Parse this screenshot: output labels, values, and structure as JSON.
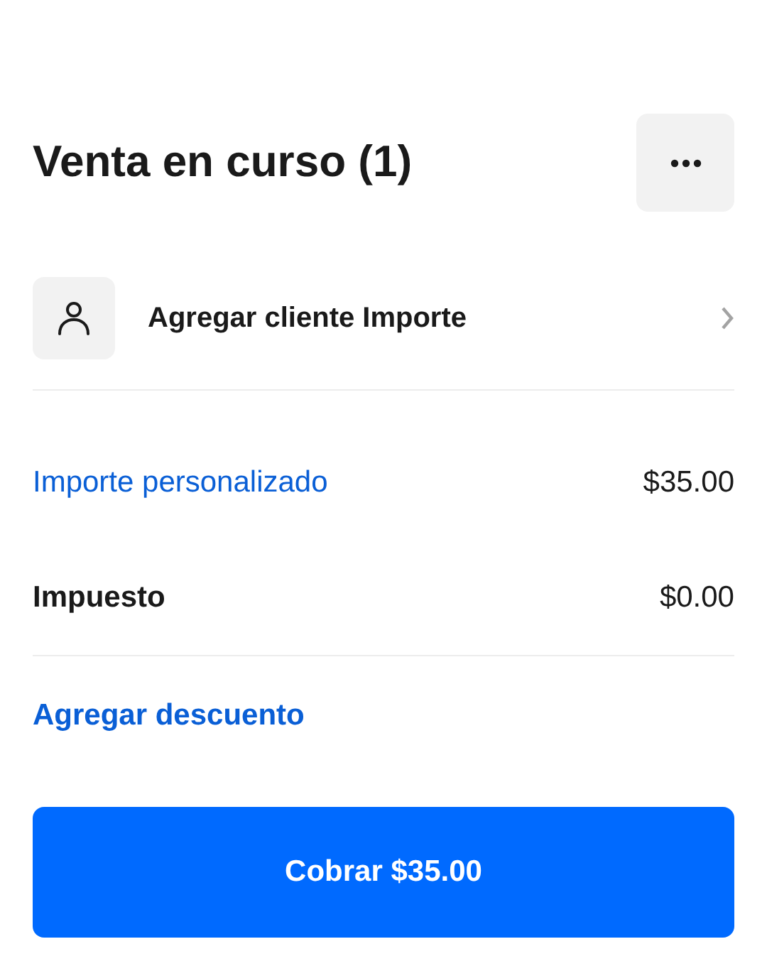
{
  "header": {
    "title": "Venta en curso (1)"
  },
  "customer": {
    "label": "Agregar cliente Importe"
  },
  "lines": [
    {
      "kind": "link",
      "label": "Importe personalizado",
      "amount": "$35.00"
    },
    {
      "kind": "text",
      "label": "Impuesto",
      "amount": "$0.00"
    }
  ],
  "discount_link": "Agregar descuento",
  "charge_button": "Cobrar $35.00"
}
